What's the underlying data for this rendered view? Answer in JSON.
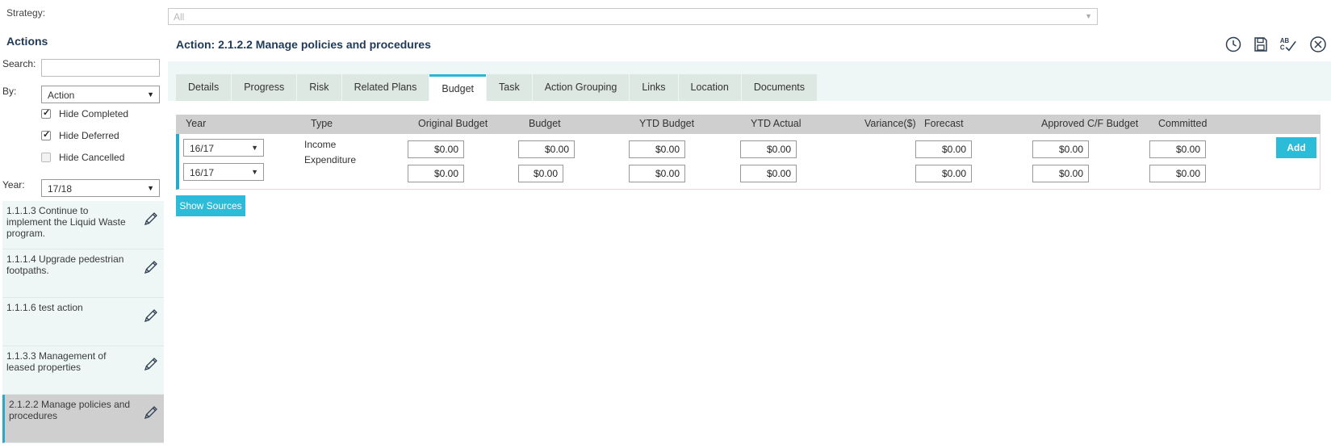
{
  "strategy": {
    "label": "Strategy:",
    "value": "All"
  },
  "sidebar": {
    "title": "Actions",
    "search_label": "Search:",
    "search_value": "",
    "by_label": "By:",
    "by_value": "Action",
    "hide_completed": {
      "label": "Hide Completed",
      "checked": true
    },
    "hide_deferred": {
      "label": "Hide Deferred",
      "checked": true
    },
    "hide_cancelled": {
      "label": "Hide Cancelled",
      "checked": false
    },
    "year_label": "Year:",
    "year_value": "17/18",
    "items": [
      {
        "label": "1.1.1.3 Continue to implement the Liquid Waste program."
      },
      {
        "label": "1.1.1.4 Upgrade pedestrian footpaths."
      },
      {
        "label": "1.1.1.6 test action"
      },
      {
        "label": "1.1.3.3 Management of leased properties"
      },
      {
        "label": "2.1.2.2 Manage policies and procedures",
        "selected": true
      }
    ]
  },
  "main": {
    "title": "Action: 2.1.2.2 Manage policies and procedures",
    "header_icons": [
      "clock-icon",
      "save-icon",
      "spellcheck-icon",
      "close-icon"
    ],
    "tabs": [
      {
        "label": "Details"
      },
      {
        "label": "Progress"
      },
      {
        "label": "Risk"
      },
      {
        "label": "Related Plans"
      },
      {
        "label": "Budget",
        "active": true
      },
      {
        "label": "Task"
      },
      {
        "label": "Action Grouping"
      },
      {
        "label": "Links"
      },
      {
        "label": "Location"
      },
      {
        "label": "Documents"
      }
    ],
    "table": {
      "columns": [
        "Year",
        "Type",
        "Original Budget",
        "Budget",
        "YTD Budget",
        "YTD Actual",
        "Variance($)",
        "Forecast",
        "Approved C/F Budget",
        "Committed"
      ],
      "rows": [
        {
          "year": "16/17",
          "type": "Income",
          "original_budget": "$0.00",
          "budget": "$0.00",
          "ytd_budget": "$0.00",
          "ytd_actual": "$0.00",
          "forecast": "$0.00",
          "approved_cf": "$0.00",
          "committed": "$0.00"
        },
        {
          "year": "16/17",
          "type": "Expenditure",
          "original_budget": "$0.00",
          "budget": "$0.00",
          "ytd_budget": "$0.00",
          "ytd_actual": "$0.00",
          "forecast": "$0.00",
          "approved_cf": "$0.00",
          "committed": "$0.00"
        }
      ]
    },
    "add_label": "Add",
    "show_sources_label": "Show Sources"
  },
  "colors": {
    "accent": "#2bbcd8",
    "title": "#1f3a57",
    "tab_bg": "#dde8e2",
    "strip_bg": "#eef6f6"
  }
}
